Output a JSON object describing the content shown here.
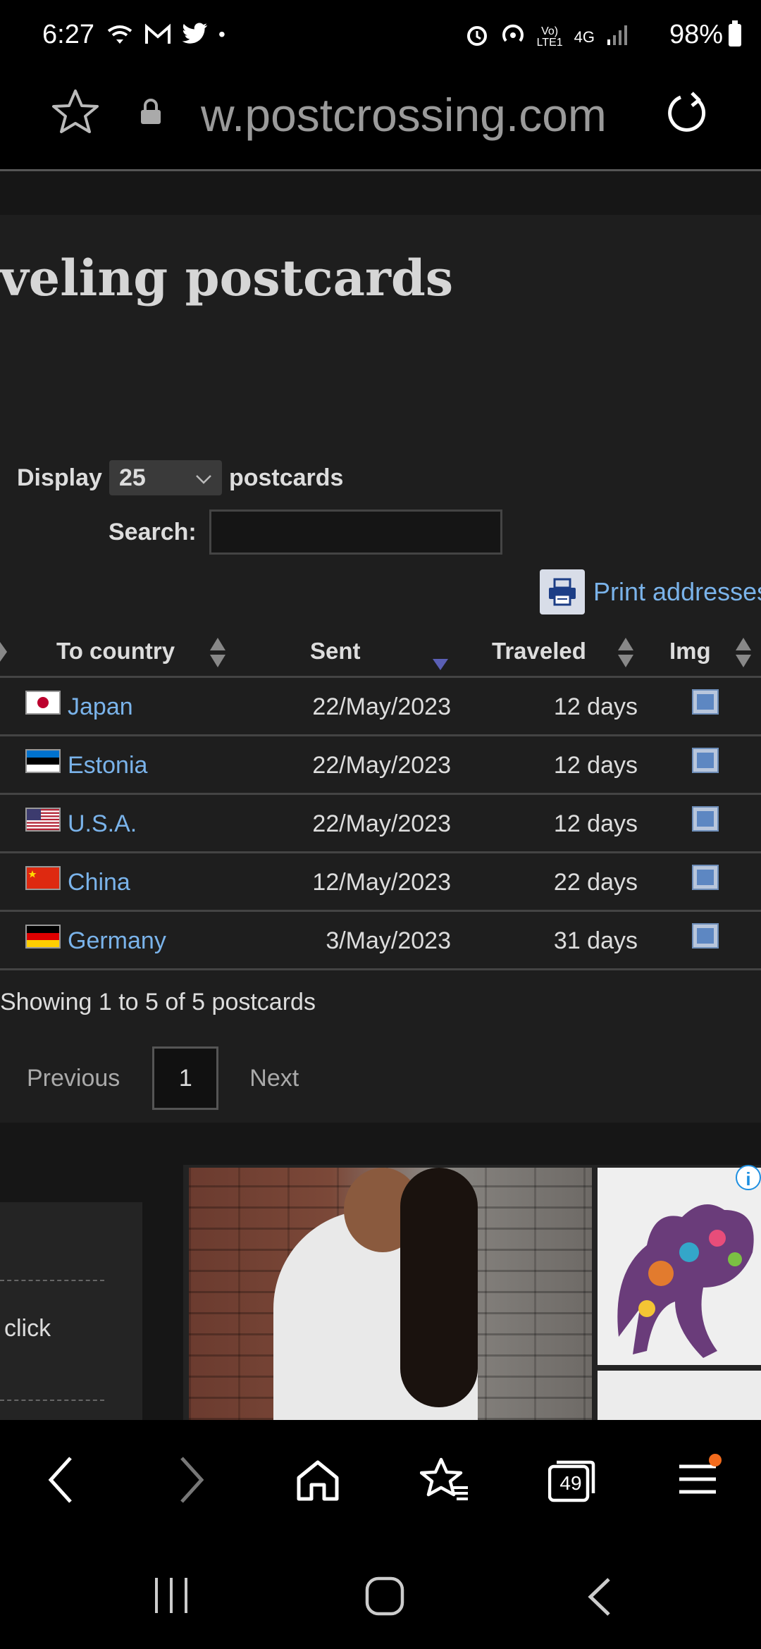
{
  "status_bar": {
    "time": "6:27",
    "battery": "98%",
    "network": "4G"
  },
  "browser": {
    "url": "w.postcrossing.com",
    "tab_count": "49"
  },
  "page": {
    "title": "veling postcards",
    "display_label": "Display",
    "display_value": "25",
    "display_suffix": "postcards",
    "search_label": "Search:",
    "search_value": "",
    "print_label": "Print addresses",
    "columns": [
      "To country",
      "Sent",
      "Traveled",
      "Img"
    ],
    "rows": [
      {
        "country": "Japan",
        "sent": "22/May/2023",
        "traveled": "12 days",
        "flag": "japan"
      },
      {
        "country": "Estonia",
        "sent": "22/May/2023",
        "traveled": "12 days",
        "flag": "estonia"
      },
      {
        "country": "U.S.A.",
        "sent": "22/May/2023",
        "traveled": "12 days",
        "flag": "usa"
      },
      {
        "country": "China",
        "sent": "12/May/2023",
        "traveled": "22 days",
        "flag": "china"
      },
      {
        "country": "Germany",
        "sent": "3/May/2023",
        "traveled": "31 days",
        "flag": "germany"
      }
    ],
    "showing": "Showing 1 to 5 of 5 postcards",
    "pager": {
      "previous": "Previous",
      "page": "1",
      "next": "Next"
    },
    "sidebar_text": "click"
  },
  "colors": {
    "link": "#7ab3ea",
    "background": "#1e1e1e",
    "sort_active": "#5a5fb5"
  }
}
